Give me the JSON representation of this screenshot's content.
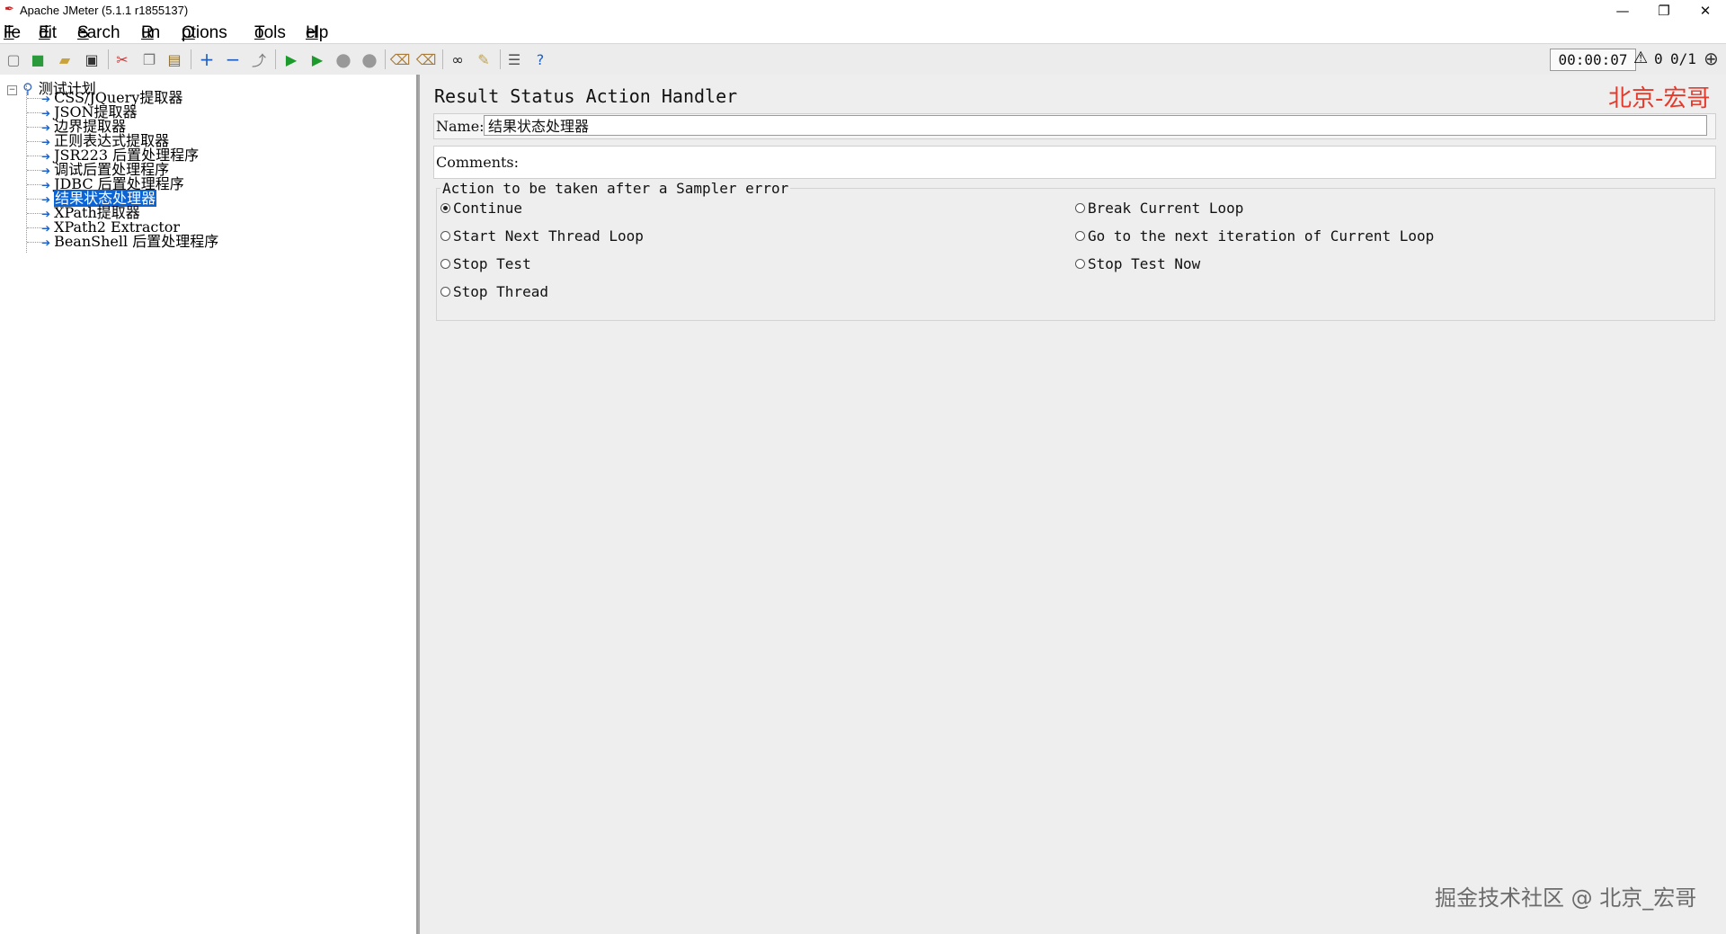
{
  "window": {
    "title": "Apache JMeter (5.1.1 r1855137)"
  },
  "menu": [
    {
      "rest": "ile",
      "key": "F"
    },
    {
      "rest": "dit",
      "key": "E"
    },
    {
      "rest": "earch",
      "key": "S"
    },
    {
      "rest": "un",
      "key": "R"
    },
    {
      "rest": "ptions",
      "key": "O"
    },
    {
      "rest": "ools",
      "key": "T"
    },
    {
      "rest": "elp",
      "key": "H"
    }
  ],
  "status": {
    "timer": "00:00:07",
    "errors": "0",
    "threads": "0/1"
  },
  "tree": {
    "root": "测试计划",
    "items": [
      "CSS/JQuery提取器",
      "JSON提取器",
      "边界提取器",
      "正则表达式提取器",
      "JSR223 后置处理程序",
      "调试后置处理程序",
      "JDBC 后置处理程序",
      "结果状态处理器",
      "XPath提取器",
      "XPath2 Extractor",
      "BeanShell 后置处理程序"
    ],
    "selected_index": 7
  },
  "panel": {
    "title": "Result Status Action Handler",
    "watermark_top": "北京-宏哥",
    "name_label": "Name:",
    "name_value": "结果状态处理器",
    "comments_label": "Comments:",
    "group_title": "Action to be taken after a Sampler error",
    "options": {
      "continue": "Continue",
      "start_next_thread_loop": "Start Next Thread Loop",
      "stop_test": "Stop Test",
      "stop_thread": "Stop Thread",
      "break_current_loop": "Break Current Loop",
      "go_next_iteration": "Go to the next iteration of Current Loop",
      "stop_test_now": "Stop Test Now"
    },
    "selected_option": "continue"
  },
  "watermark_bottom": "掘金技术社区 @ 北京_宏哥"
}
